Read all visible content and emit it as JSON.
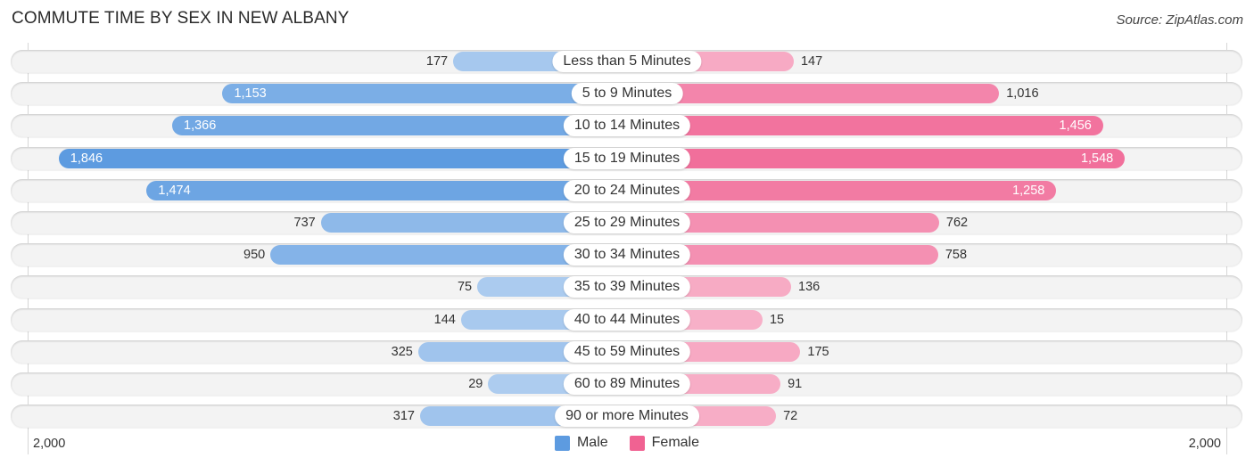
{
  "chart_data": {
    "type": "bar",
    "orientation": "horizontal-diverging",
    "title": "COMMUTE TIME BY SEX IN NEW ALBANY",
    "source": "Source: ZipAtlas.com",
    "categories": [
      "Less than 5 Minutes",
      "5 to 9 Minutes",
      "10 to 14 Minutes",
      "15 to 19 Minutes",
      "20 to 24 Minutes",
      "25 to 29 Minutes",
      "30 to 34 Minutes",
      "35 to 39 Minutes",
      "40 to 44 Minutes",
      "45 to 59 Minutes",
      "60 to 89 Minutes",
      "90 or more Minutes"
    ],
    "series": [
      {
        "name": "Male",
        "color": "#5d9be0",
        "values": [
          177,
          1153,
          1366,
          1846,
          1474,
          737,
          950,
          75,
          144,
          325,
          29,
          317
        ],
        "labels": [
          "177",
          "1,153",
          "1,366",
          "1,846",
          "1,474",
          "737",
          "950",
          "75",
          "144",
          "325",
          "29",
          "317"
        ]
      },
      {
        "name": "Female",
        "color": "#f06292",
        "values": [
          147,
          1016,
          1456,
          1548,
          1258,
          762,
          758,
          136,
          15,
          175,
          91,
          72
        ],
        "labels": [
          "147",
          "1,016",
          "1,456",
          "1,548",
          "1,258",
          "762",
          "758",
          "136",
          "15",
          "175",
          "91",
          "72"
        ]
      }
    ],
    "xlim": [
      -2000,
      2000
    ],
    "tick_labels": {
      "left": "2,000",
      "right": "2,000"
    },
    "legend": {
      "position": "bottom-center",
      "items": [
        "Male",
        "Female"
      ]
    },
    "grid": false
  }
}
